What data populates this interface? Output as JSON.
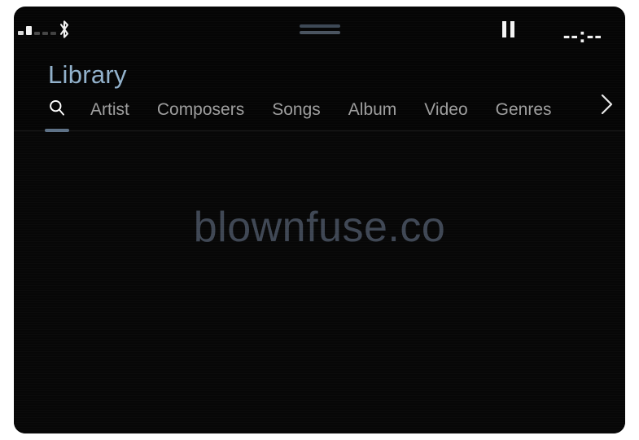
{
  "status_bar": {
    "signal_icon": "signal-strength-icon",
    "signal_bars_active": 2,
    "signal_bars_total": 5,
    "bluetooth_icon": "bluetooth-icon",
    "drag_handle_icon": "drag-handle-icon",
    "playback_state_icon": "pause-icon",
    "clock": "--:--"
  },
  "header": {
    "title": "Library"
  },
  "tabs": {
    "search_icon": "search-icon",
    "items": [
      {
        "label": "Artist",
        "active": false
      },
      {
        "label": "Composers",
        "active": false
      },
      {
        "label": "Songs",
        "active": false
      },
      {
        "label": "Album",
        "active": false
      },
      {
        "label": "Video",
        "active": false
      },
      {
        "label": "Genres",
        "active": false
      }
    ],
    "overflow_icon": "chevron-right-icon",
    "active_tab": "search"
  },
  "content": {
    "watermark": "blownfuse.co"
  },
  "colors": {
    "screen_background": "#050505",
    "content_background": "#070707",
    "title_accent": "#92b2cc",
    "tab_inactive": "#9e9e9e",
    "tab_active": "#ffffff",
    "tab_underline": "#5d7186",
    "watermark": "#3f4754",
    "handle": "#49535f",
    "bezel": "#ffffff"
  }
}
